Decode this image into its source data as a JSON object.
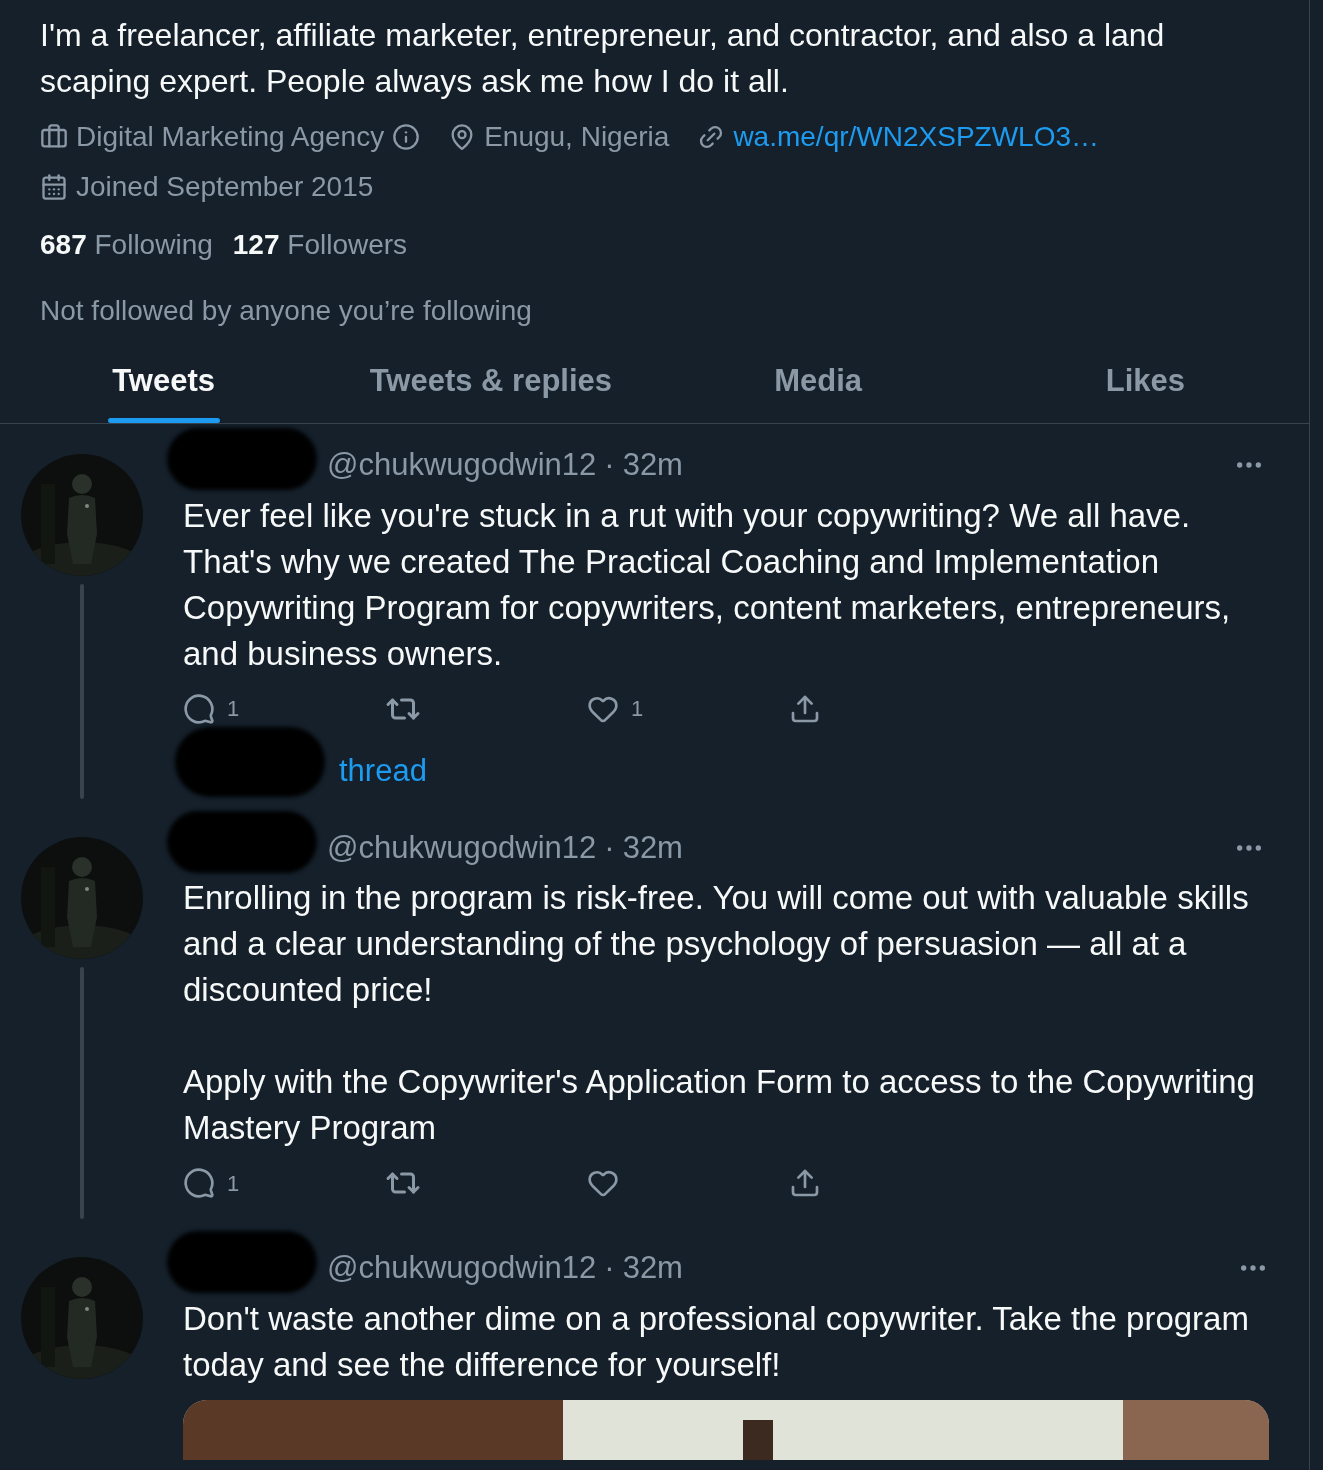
{
  "profile": {
    "bio": "I'm a freelancer, affiliate marketer, entrepreneur, and contractor, and also a land scaping expert. People always ask me how I do it all.",
    "meta": [
      {
        "kind": "category",
        "text": "Digital Marketing Agency"
      },
      {
        "kind": "location",
        "text": "Enugu, Nigeria"
      },
      {
        "kind": "link",
        "text": "wa.me/qr/WN2XSPZWLO3…"
      },
      {
        "kind": "joined",
        "text": "Joined September 2015"
      }
    ],
    "stats": [
      {
        "count": "687",
        "label": "Following"
      },
      {
        "count": "127",
        "label": "Followers"
      }
    ],
    "not_followed": "Not followed by anyone you’re following"
  },
  "tabs": [
    {
      "label": "Tweets",
      "selected": true
    },
    {
      "label": "Tweets & replies",
      "selected": false
    },
    {
      "label": "Media",
      "selected": false
    },
    {
      "label": "Likes",
      "selected": false
    }
  ],
  "tweets": [
    {
      "handle": "@chukwugodwin12",
      "separator": "·",
      "time": "32m",
      "paragraphs": [
        "Ever feel like you're stuck in a rut with your copywriting? We all have. That's why we created The Practical Coaching and Implementation Copywriting Program for copywriters, content marketers, entrepreneurs, and business owners."
      ],
      "replies": "1",
      "likes": "1",
      "show_thread": "thread"
    },
    {
      "handle": "@chukwugodwin12",
      "separator": "·",
      "time": "32m",
      "paragraphs": [
        "Enrolling in the program is risk-free. You will come out with valuable skills and a clear understanding of the psychology of persuasion — all at a discounted price!",
        "Apply with the Copywriter's Application Form to access to the Copywriting Mastery Program"
      ],
      "replies": "1"
    },
    {
      "handle": "@chukwugodwin12",
      "separator": "·",
      "time": "32m",
      "paragraphs": [
        "Don't waste another dime on a professional copywriter. Take the program today and see the difference for yourself!"
      ],
      "media": {
        "kind": "picture"
      }
    }
  ]
}
